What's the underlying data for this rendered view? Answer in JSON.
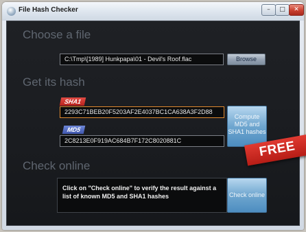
{
  "window": {
    "title": "File Hash Checker",
    "controls": {
      "minimize": "–",
      "maximize": "□",
      "close": "✕"
    }
  },
  "sections": {
    "choose": "Choose a file",
    "hash": "Get its hash",
    "online": "Check online"
  },
  "file": {
    "path": "C:\\Tmp\\[1989] Hunkpapa\\01 - Devil's Roof.flac",
    "browse_label": "Browse"
  },
  "hash": {
    "sha1_label": "SHA1",
    "sha1_value": "2293C71BEB20F5203AF2E4037BC1CA638A3F2D88",
    "md5_label": "MD5",
    "md5_value": "2C8213E0F919AC684B7F172C8020881C",
    "compute_label_lines": [
      "Compute",
      "MD5 and",
      "SHA1 hashes"
    ]
  },
  "online": {
    "info_text": "Click on \"Check online\" to verify the result against a list of known MD5 and SHA1 hashes",
    "check_label": "Check online"
  },
  "badge": {
    "text": "FREE"
  },
  "colors": {
    "background_dark": "#1a1c20",
    "sha1_tag": "#c8231d",
    "md5_tag": "#4f67c2",
    "accent_blue": "#6fa6cf",
    "free_banner": "#c9261f"
  }
}
